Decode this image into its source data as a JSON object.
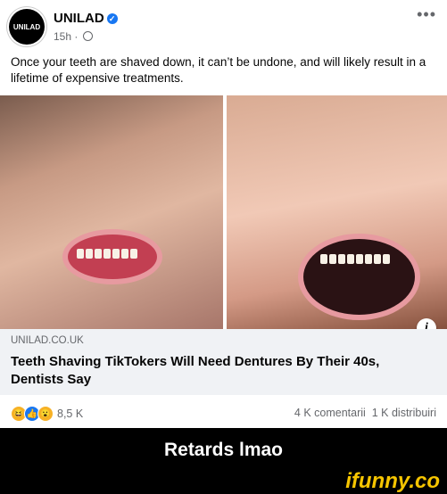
{
  "post": {
    "page_name": "UNILAD",
    "avatar_text": "UNILAD",
    "time": "15h ·",
    "text": "Once your teeth are shaved down, it can’t be undone, and will likely result in a lifetime of expensive treatments.",
    "more_label": "•••"
  },
  "link": {
    "domain": "UNILAD.CO.UK",
    "title": "Teeth Shaving TikTokers Will Need Dentures By Their 40s, Dentists Say"
  },
  "stats": {
    "reactions_count": "8,5 K",
    "comments": "4 K comentarii",
    "shares": "1 K distribuiri"
  },
  "caption": "Retards lmao",
  "brand": "ifunny.co",
  "colors": {
    "verified": "#1877f2",
    "brand": "#f6c500",
    "link_bg": "#f0f2f5"
  }
}
